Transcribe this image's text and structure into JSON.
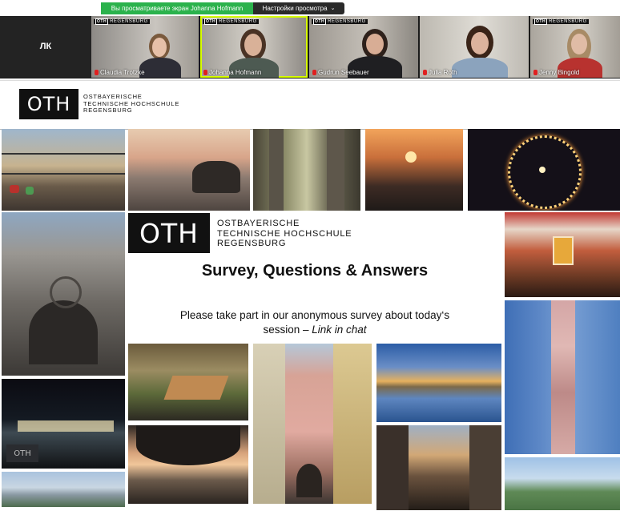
{
  "share_banner": {
    "message": "Вы просматриваете экран Johanna Hofmann",
    "view_settings_label": "Настройки просмотра",
    "chevron_icon": "chevron-down-icon"
  },
  "participants": [
    {
      "initials": "ЛК",
      "name": ""
    },
    {
      "name": "Claudia Trotzke",
      "tag": "REGENSBURG",
      "muted": true
    },
    {
      "name": "Johanna Hofmann",
      "tag": "REGENSBURG",
      "muted": true
    },
    {
      "name": "Gudrun Seebauer",
      "tag": "REGENSBURG",
      "muted": true
    },
    {
      "name": "Julia Roth",
      "tag": "",
      "muted": true
    },
    {
      "name": "Jenny Bingold",
      "tag": "REGENSBURG",
      "muted": true
    }
  ],
  "slide": {
    "logo_mark": "OTH",
    "logo_lines": [
      "OSTBAYERISCHE",
      "TECHNISCHE HOCHSCHULE",
      "REGENSBURG"
    ],
    "title": "Survey, Questions & Answers",
    "body_line1": "Please take part in our anonymous survey about today‘s",
    "body_line2_prefix": "session – ",
    "body_link": "Link in chat"
  },
  "colors": {
    "banner_green": "#2bb24c",
    "active_speaker": "#d8ff00",
    "mic_muted": "#e02020"
  }
}
